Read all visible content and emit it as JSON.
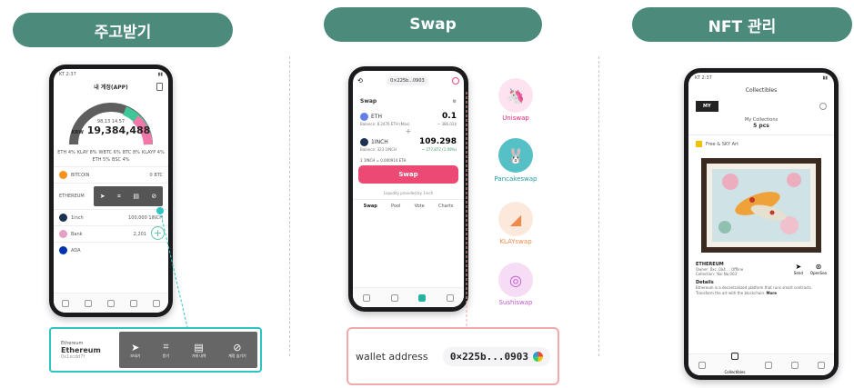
{
  "panels": {
    "wallet": {
      "title": "주고받기"
    },
    "swap": {
      "title": "Swap"
    },
    "nft": {
      "title": "NFT 관리"
    }
  },
  "wallet_phone": {
    "status_time": "KT 2:37",
    "header": "내 계정(APP)",
    "total_small": "98,13 14.57",
    "total_currency": "KRW",
    "total": "19,384,488",
    "legend": [
      "ETH 4%",
      "KLAY 8%",
      "WBTC 6%",
      "BTC 8%",
      "KLAYP 4%",
      "ETH 5%",
      "BSC 4%"
    ],
    "assets": [
      {
        "symbol": "BITCOIN",
        "name": "BITCOIN",
        "value": "0 BTC",
        "color": "#f7931a"
      },
      {
        "symbol": "ETHEREUM",
        "name": "ETHEREUM",
        "value": "",
        "color": "#627eea"
      },
      {
        "symbol": "1inch",
        "name": "1inch",
        "value": "100,000 1INCH",
        "color": "#1b314f"
      },
      {
        "symbol": "Bank",
        "name": "Bank",
        "value": "2,201",
        "color": "#e6a0c4"
      },
      {
        "symbol": "ADA",
        "name": "ADA",
        "value": "",
        "color": "#0033ad"
      }
    ],
    "actions": [
      "보내기",
      "받기",
      "거래내역",
      "계정 숨기기"
    ]
  },
  "callout": {
    "chain": "Ethereum",
    "name": "Ethereum",
    "address": "0x1xcdd7f",
    "actions": [
      "보내기",
      "받기",
      "거래 내역",
      "계정 숨기기"
    ]
  },
  "swap_phone": {
    "address": "0×225b...0903",
    "section": "Swap",
    "from_token": "ETH",
    "from_amount": "0.1",
    "from_balance": "Balance: 8.2476 ETH (Max)",
    "from_value": "~ 386.02$",
    "to_token": "1INCH",
    "to_amount": "109.298",
    "to_balance": "Balance: 323 1INCH",
    "to_value": "~ 277.872 (1.09%)",
    "rate": "1 1INCH = 0.000914 ETH",
    "button": "Swap",
    "powered": "Liquidity provided by 1inch",
    "tabs": [
      "Swap",
      "Pool",
      "Vote",
      "Charts"
    ]
  },
  "dexes": [
    {
      "name": "Uniswap",
      "icon": "🦄",
      "bg": "#fde3ef",
      "color": "#e3287a"
    },
    {
      "name": "Pancakeswap",
      "icon": "🐰",
      "bg": "#55c0c6",
      "color": "#1f9ba3"
    },
    {
      "name": "KLAYswap",
      "icon": "◢",
      "bg": "#fde9dc",
      "color": "#f08a4b"
    },
    {
      "name": "Sushiswap",
      "icon": "◎",
      "bg": "#f6dcf5",
      "color": "#c05ad0"
    }
  ],
  "wallet_box": {
    "label": "wallet address",
    "value": "0×225b...0903"
  },
  "nft_phone": {
    "status_time": "KT 2:37",
    "header": "Collectibles",
    "tab": "MY",
    "collections_label": "My Collections",
    "collections_count": "5 pcs",
    "collection_name": "Free & SKY Art",
    "chain": "ETHEREUM",
    "owner": "Owner: 0xc..0a4 ... Offline",
    "collection": "Collection: 'Koi No.003'",
    "details_label": "Details",
    "details_text": "Ethereum is a decentralized platform that runs smart contracts. Transform the art with the blockchain.",
    "more": "More",
    "send": "Send",
    "opensea": "OpenSea",
    "nav": [
      "Wallet",
      "Collectibles",
      "Swap",
      "Browser",
      "Settings"
    ]
  },
  "colors": {
    "accent": "#4c8a7c",
    "swap_pink": "#ec4a74",
    "callout_teal": "#2ec4c4",
    "wallet_box_border": "#f1a9a9"
  }
}
